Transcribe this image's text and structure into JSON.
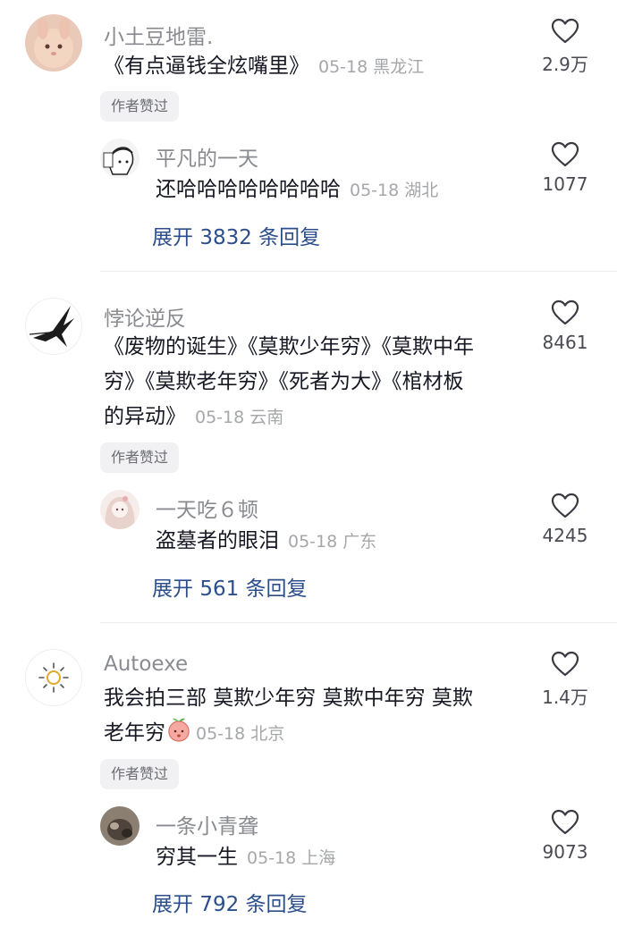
{
  "threads": [
    {
      "comment": {
        "username": "小土豆地雷.",
        "lines": [
          "《有点逼钱全炫嘴里》"
        ],
        "date": "05-18",
        "location": "黑龙江",
        "likes": "2.9万"
      },
      "badge": "作者赞过",
      "reply": {
        "username": "平凡的一天",
        "text": "还哈哈哈哈哈哈哈哈",
        "date": "05-18",
        "location": "湖北",
        "likes": "1077"
      },
      "expand": {
        "prefix": "展开",
        "count": "3832",
        "suffix": "条回复"
      }
    },
    {
      "comment": {
        "username": "悖论逆反",
        "lines": [
          "《废物的诞生》《莫欺少年穷》《莫欺中年",
          "穷》《莫欺老年穷》《死者为大》《棺材板",
          "的异动》"
        ],
        "date": "05-18",
        "location": "云南",
        "likes": "8461"
      },
      "badge": "作者赞过",
      "reply": {
        "username": "一天吃６顿",
        "text": "盗墓者的眼泪",
        "date": "05-18",
        "location": "广东",
        "likes": "4245"
      },
      "expand": {
        "prefix": "展开",
        "count": "561",
        "suffix": "条回复"
      }
    },
    {
      "comment": {
        "username": "Autoexe",
        "lines": [
          "我会拍三部  莫欺少年穷  莫欺中年穷  莫欺",
          "老年穷"
        ],
        "date": "05-18",
        "location": "北京",
        "likes": "1.4万"
      },
      "badge": "作者赞过",
      "reply": {
        "username": "一条小青聋",
        "text": "穷其一生",
        "date": "05-18",
        "location": "上海",
        "likes": "9073"
      },
      "expand": {
        "prefix": "展开",
        "count": "792",
        "suffix": "条回复"
      }
    }
  ],
  "colors": {
    "text": "#161823",
    "username": "#8a8b91",
    "meta": "#a6a7ab",
    "link": "#2c4f8c",
    "badge_bg": "#f1f1f3"
  },
  "icons": {
    "like": "heart-outline-icon",
    "emoji": "peach-emoji-icon"
  }
}
